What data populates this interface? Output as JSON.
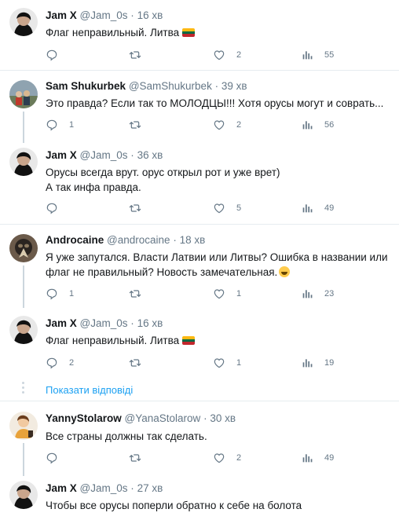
{
  "tweets": [
    {
      "name": "Jam X",
      "handle": "@Jam_0s",
      "time": "16 хв",
      "lines": [
        "Флаг неправильный. Литва"
      ],
      "flag": true,
      "reply_count": "",
      "like_count": "2",
      "views_count": "55"
    },
    {
      "name": "Sam Shukurbek",
      "handle": "@SamShukurbek",
      "time": "39 хв",
      "lines": [
        "Это правда? Если так то МОЛОДЦЫ!!! Хотя орусы могут и соврать..."
      ],
      "reply_count": "1",
      "like_count": "2",
      "views_count": "56"
    },
    {
      "name": "Jam X",
      "handle": "@Jam_0s",
      "time": "36 хв",
      "lines": [
        "Орусы всегда врут. орус открыл рот и уже врет)",
        "А так инфа правда."
      ],
      "reply_count": "",
      "like_count": "5",
      "views_count": "49"
    },
    {
      "name": "Androcaine",
      "handle": "@androcaine",
      "time": "18 хв",
      "lines": [
        "Я уже запутался. Власти Латвии или Литвы? Ошибка в названии или",
        "флаг не правильный? Новость замечательная."
      ],
      "emoji": "grinning-face",
      "reply_count": "1",
      "like_count": "1",
      "views_count": "23"
    },
    {
      "name": "Jam X",
      "handle": "@Jam_0s",
      "time": "16 хв",
      "lines": [
        "Флаг неправильный. Литва"
      ],
      "flag": true,
      "reply_count": "2",
      "like_count": "1",
      "views_count": "19"
    },
    {
      "name": "YannyStolarow",
      "handle": "@YanaStolarow",
      "time": "30 хв",
      "lines": [
        "Все страны должны так сделать."
      ],
      "reply_count": "",
      "like_count": "2",
      "views_count": "49"
    },
    {
      "name": "Jam X",
      "handle": "@Jam_0s",
      "time": "27 хв",
      "lines": [
        "Чтобы все орусы поперли обратно к себе на болота"
      ]
    }
  ],
  "show_replies_label": "Показати відповіді",
  "separator": "·",
  "colors": {
    "accent": "#1da1f2",
    "meta": "#657786",
    "text": "#14171a",
    "thread_line": "#ccd6dd",
    "flag_lithuania": [
      "#fdb913",
      "#006a44",
      "#c1272d"
    ]
  },
  "icons": [
    "reply-icon",
    "retweet-icon",
    "like-icon",
    "views-icon"
  ]
}
